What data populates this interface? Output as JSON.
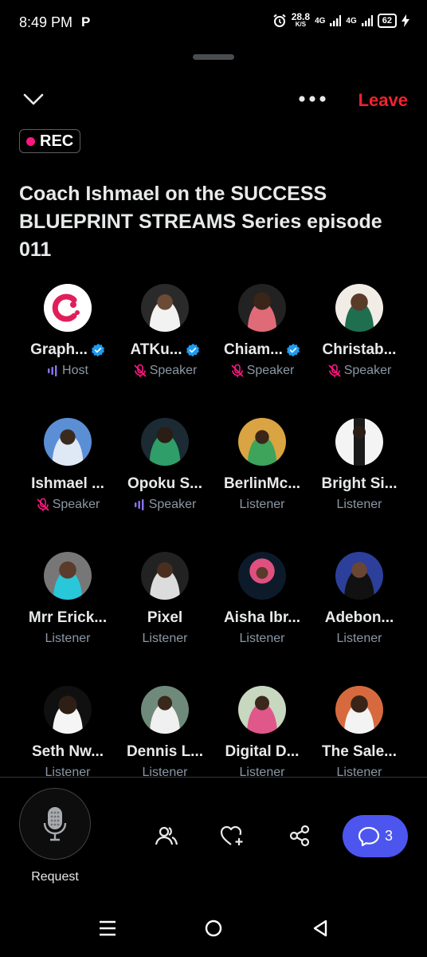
{
  "status_bar": {
    "time": "8:49 PM",
    "app_indicator": "P",
    "speed_value": "28.8",
    "speed_unit": "K/S",
    "net1": "4G",
    "net2": "4G",
    "battery": "62"
  },
  "header": {
    "leave_label": "Leave",
    "rec_label": "REC"
  },
  "space": {
    "title": "Coach Ishmael on the SUCCESS BLUEPRINT STREAMS Series episode 011"
  },
  "participants": [
    {
      "name": "Graph...",
      "role": "Host",
      "verified": true,
      "role_icon": "waveform-icon",
      "avatar": "logo"
    },
    {
      "name": "ATKu...",
      "role": "Speaker",
      "verified": true,
      "role_icon": "mic-muted-icon",
      "avatar": "photo"
    },
    {
      "name": "Chiam...",
      "role": "Speaker",
      "verified": true,
      "role_icon": "mic-muted-icon",
      "avatar": "photo"
    },
    {
      "name": "Christab...",
      "role": "Speaker",
      "verified": false,
      "role_icon": "mic-muted-icon",
      "avatar": "photo"
    },
    {
      "name": "Ishmael ...",
      "role": "Speaker",
      "verified": false,
      "role_icon": "mic-muted-icon",
      "avatar": "photo"
    },
    {
      "name": "Opoku S...",
      "role": "Speaker",
      "verified": false,
      "role_icon": "waveform-icon",
      "avatar": "photo"
    },
    {
      "name": "BerlinMc...",
      "role": "Listener",
      "verified": false,
      "role_icon": "",
      "avatar": "photo"
    },
    {
      "name": "Bright Si...",
      "role": "Listener",
      "verified": false,
      "role_icon": "",
      "avatar": "photo"
    },
    {
      "name": "Mrr Erick...",
      "role": "Listener",
      "verified": false,
      "role_icon": "",
      "avatar": "photo"
    },
    {
      "name": "Pixel",
      "role": "Listener",
      "verified": false,
      "role_icon": "",
      "avatar": "photo"
    },
    {
      "name": "Aisha Ibr...",
      "role": "Listener",
      "verified": false,
      "role_icon": "",
      "avatar": "photo"
    },
    {
      "name": "Adebon...",
      "role": "Listener",
      "verified": false,
      "role_icon": "",
      "avatar": "photo"
    },
    {
      "name": "Seth Nw...",
      "role": "Listener",
      "verified": false,
      "role_icon": "",
      "avatar": "photo"
    },
    {
      "name": "Dennis L...",
      "role": "Listener",
      "verified": false,
      "role_icon": "",
      "avatar": "photo"
    },
    {
      "name": "Digital D...",
      "role": "Listener",
      "verified": false,
      "role_icon": "",
      "avatar": "photo"
    },
    {
      "name": "The Sale...",
      "role": "Listener",
      "verified": false,
      "role_icon": "",
      "avatar": "photo"
    }
  ],
  "bottom_bar": {
    "request_label": "Request",
    "chat_count": "3"
  },
  "colors": {
    "background": "#000000",
    "leave": "#f4212e",
    "rec_dot": "#f91880",
    "verified": "#1d9bf0",
    "role_accent": "#8c74f3",
    "chat_button": "#4d55ef",
    "muted_text": "#8b98a5"
  }
}
